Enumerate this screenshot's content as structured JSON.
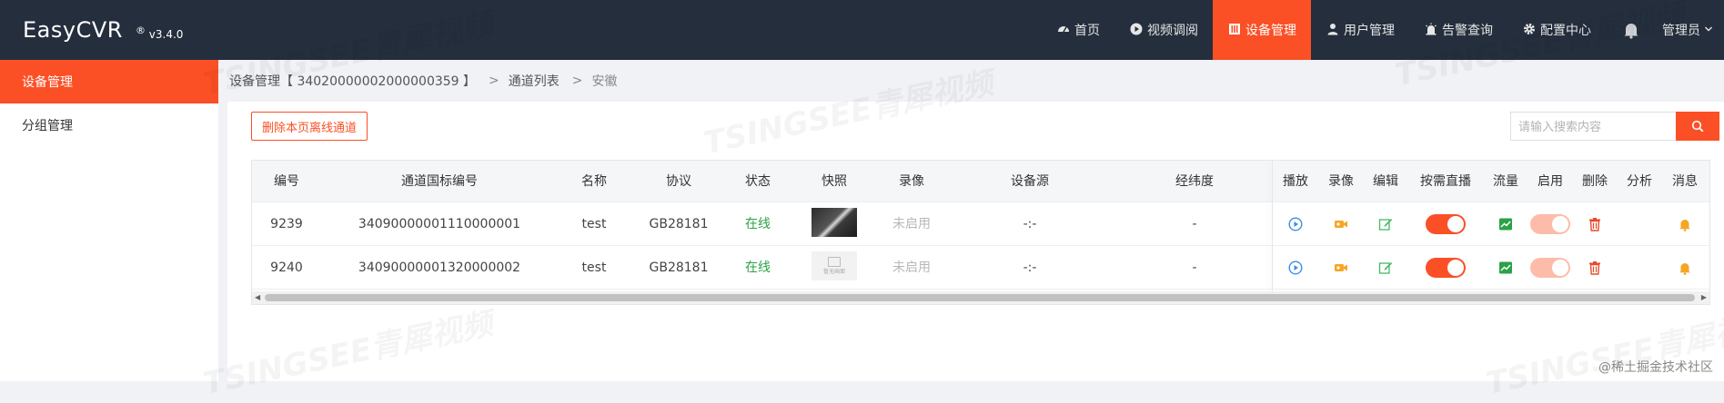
{
  "header": {
    "app_name": "EasyCVR",
    "version_mark": "®",
    "version": "v3.4.0",
    "nav": [
      {
        "label": "首页",
        "icon": "dashboard-icon",
        "active": false
      },
      {
        "label": "视频调阅",
        "icon": "play-circle-icon",
        "active": false
      },
      {
        "label": "设备管理",
        "icon": "device-icon",
        "active": true
      },
      {
        "label": "用户管理",
        "icon": "user-icon",
        "active": false
      },
      {
        "label": "告警查询",
        "icon": "alarm-icon",
        "active": false
      },
      {
        "label": "配置中心",
        "icon": "gear-icon",
        "active": false
      }
    ],
    "user": "管理员",
    "accent": "#fb4f26",
    "bg": "#252e3d"
  },
  "sidebar": {
    "items": [
      {
        "label": "设备管理",
        "active": true
      },
      {
        "label": "分组管理",
        "active": false
      }
    ]
  },
  "breadcrumb": {
    "root": "设备管理【 34020000002000000359 】",
    "sep": ">",
    "level2": "通道列表",
    "level3": "安徽"
  },
  "toolbar": {
    "delete_offline_label": "删除本页离线通道",
    "search_placeholder": "请输入搜索内容"
  },
  "table": {
    "columns": [
      "编号",
      "通道国标编号",
      "名称",
      "协议",
      "状态",
      "快照",
      "录像",
      "设备源",
      "经纬度",
      "播放",
      "录像",
      "编辑",
      "按需直播",
      "流量",
      "启用",
      "删除",
      "分析",
      "消息"
    ],
    "rows": [
      {
        "id": "9239",
        "gb_code": "34090000001110000001",
        "name": "test",
        "protocol": "GB28181",
        "status": "在线",
        "snapshot": "image",
        "record": "未启用",
        "source": "-:-",
        "latlng": "-",
        "on_demand": true,
        "enabled": true
      },
      {
        "id": "9240",
        "gb_code": "34090000001320000002",
        "name": "test",
        "protocol": "GB28181",
        "status": "在线",
        "snapshot": "placeholder",
        "snapshot_placeholder_text": "暂无画面",
        "record": "未启用",
        "source": "-:-",
        "latlng": "-",
        "on_demand": true,
        "enabled": true
      }
    ]
  },
  "watermark": "TSINGSEE青犀视频",
  "credit": "@稀土掘金技术社区"
}
